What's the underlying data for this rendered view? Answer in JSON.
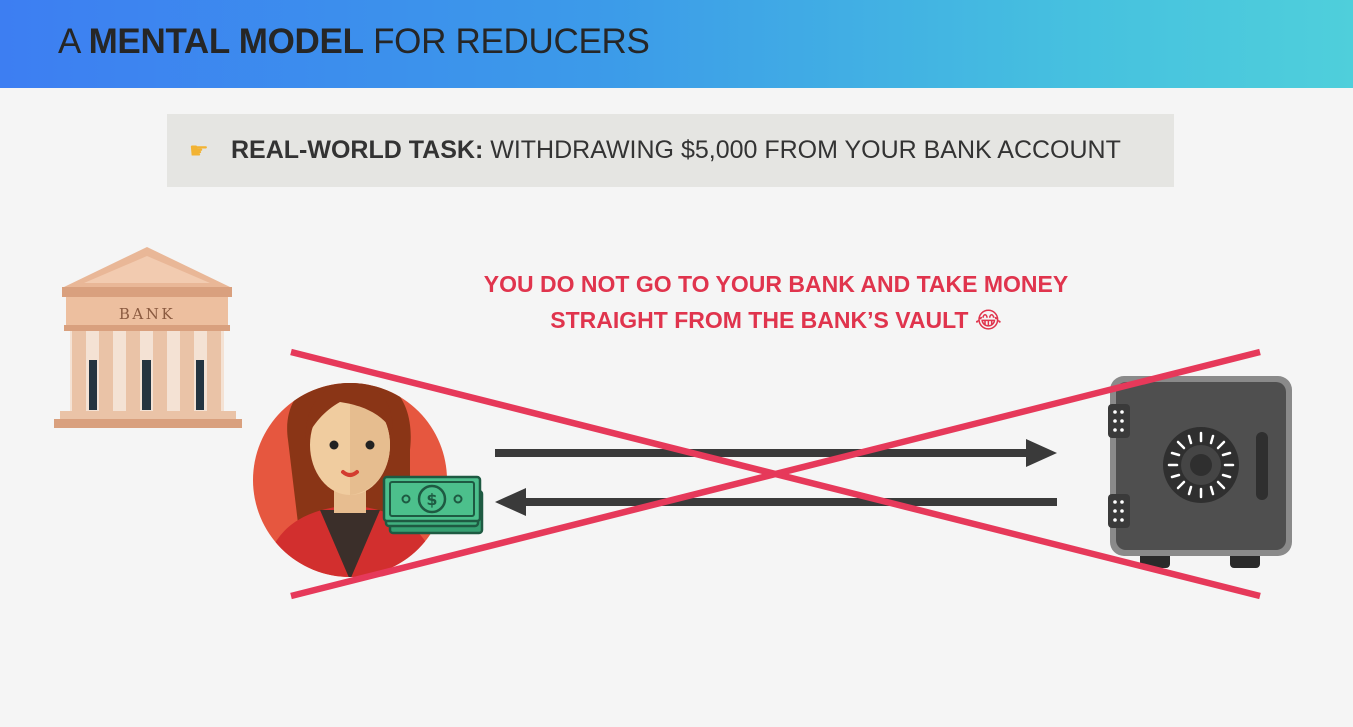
{
  "header": {
    "title_prefix": "A",
    "title_bold": "MENTAL MODEL",
    "title_suffix": "FOR REDUCERS"
  },
  "task": {
    "icon": "pointing-hand-icon",
    "label": "REAL-WORLD TASK:",
    "text": "WITHDRAWING $5,000 FROM YOUR BANK ACCOUNT"
  },
  "warning": {
    "line1_before": "YOU DO",
    "line1_emphasis": "NOT",
    "line1_after": "GO TO YOUR BANK AND TAKE MONEY",
    "line2": "STRAIGHT FROM THE BANK’S VAULT",
    "emoji": "😂"
  },
  "bank": {
    "sign": "BANK"
  },
  "colors": {
    "accent_red": "#e6395a",
    "arrow": "#3a3a3a",
    "vault": "#525252",
    "bank": "#e9b797"
  }
}
